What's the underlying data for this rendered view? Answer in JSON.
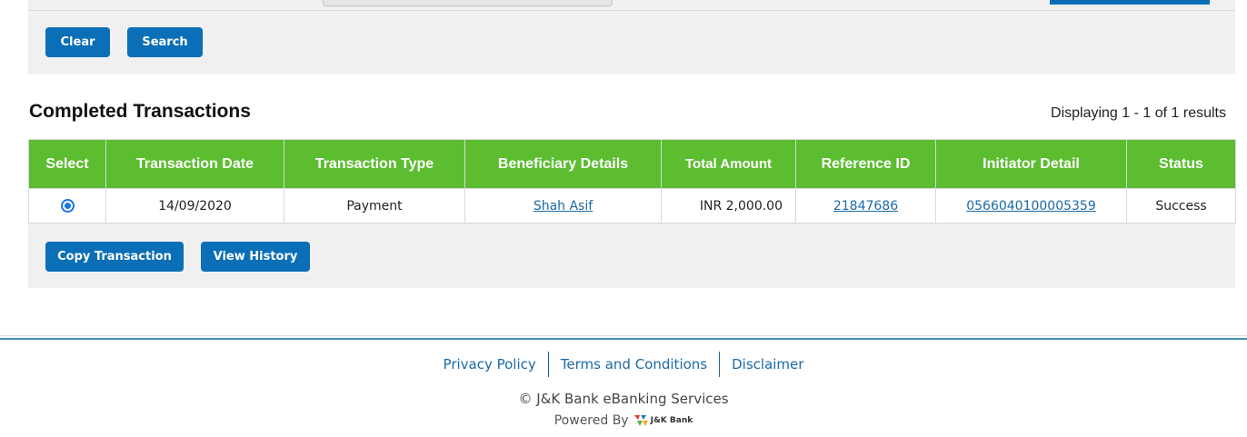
{
  "search": {
    "clear_label": "Clear",
    "search_label": "Search"
  },
  "results": {
    "title": "Completed Transactions",
    "count_text": "Displaying 1 - 1 of 1 results",
    "columns": [
      "Select",
      "Transaction Date",
      "Transaction Type",
      "Beneficiary Details",
      "Total Amount",
      "Reference ID",
      "Initiator Detail",
      "Status"
    ],
    "rows": [
      {
        "selected": true,
        "date": "14/09/2020",
        "type": "Payment",
        "beneficiary": "Shah Asif",
        "amount": "INR 2,000.00",
        "reference_id": "21847686",
        "initiator": "0566040100005359",
        "status": "Success"
      }
    ],
    "copy_label": "Copy Transaction",
    "history_label": "View History"
  },
  "footer": {
    "links": [
      "Privacy Policy",
      "Terms and Conditions",
      "Disclaimer"
    ],
    "copyright": "© J&K Bank eBanking Services",
    "powered_by": "Powered By",
    "logo_text": "J&K Bank"
  },
  "colors": {
    "button_blue": "#0a6fb6",
    "header_green": "#5cbd31",
    "link_blue": "#1a6aa8"
  }
}
